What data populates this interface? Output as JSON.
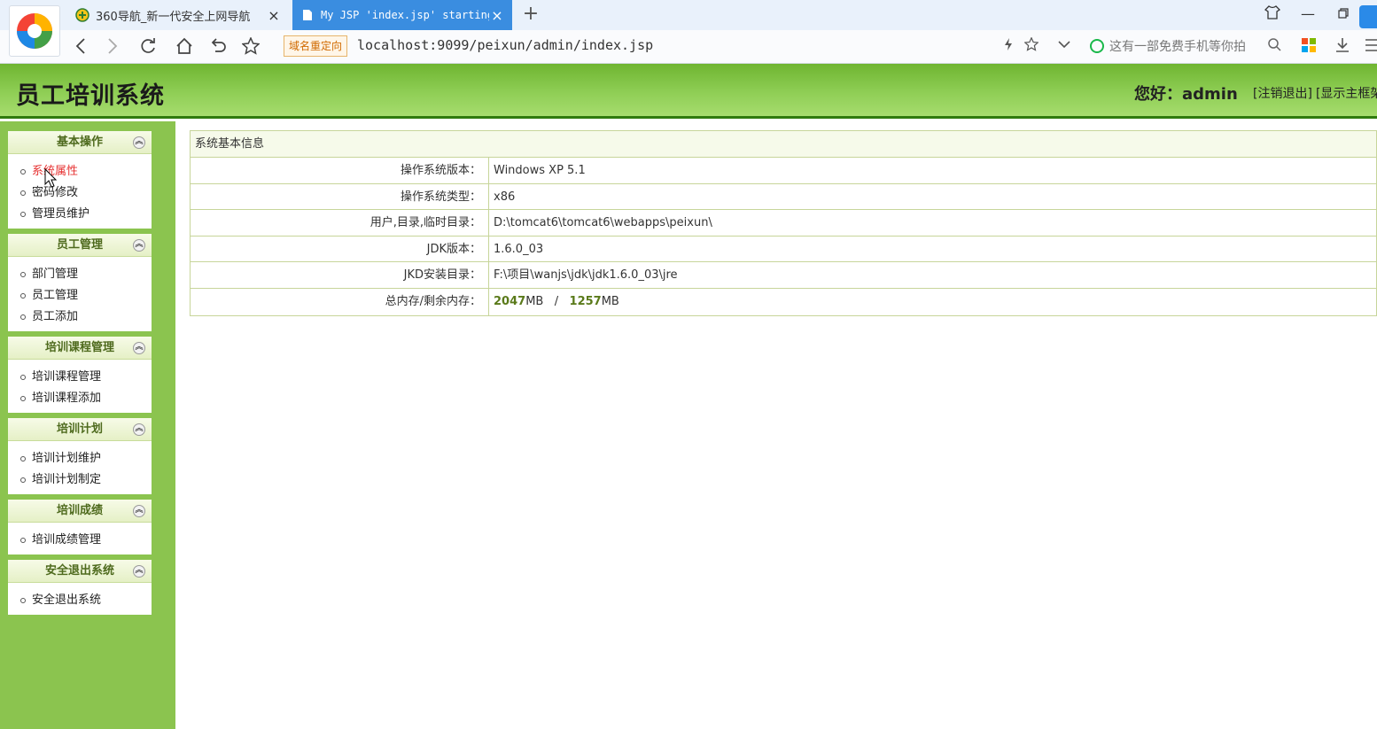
{
  "browser": {
    "tabs": [
      {
        "title": "360导航_新一代安全上网导航",
        "active": false
      },
      {
        "title": "My JSP 'index.jsp' starting",
        "active": true
      }
    ],
    "redirect_badge": "域名重定向",
    "url": "localhost:9099/peixun/admin/index.jsp",
    "search_placeholder": "这有一部免费手机等你拍",
    "accent": "#3a8de0"
  },
  "header": {
    "title": "员工培训系统",
    "greeting": "您好：admin",
    "logout_link": "[注销退出]",
    "show_frame_link": "[显示主框架"
  },
  "sidebar": {
    "groups": [
      {
        "title": "基本操作",
        "items": [
          "系统属性",
          "密码修改",
          "管理员维护"
        ]
      },
      {
        "title": "员工管理",
        "items": [
          "部门管理",
          "员工管理",
          "员工添加"
        ]
      },
      {
        "title": "培训课程管理",
        "items": [
          "培训课程管理",
          "培训课程添加"
        ]
      },
      {
        "title": "培训计划",
        "items": [
          "培训计划维护",
          "培训计划制定"
        ]
      },
      {
        "title": "培训成绩",
        "items": [
          "培训成绩管理"
        ]
      },
      {
        "title": "安全退出系统",
        "items": [
          "安全退出系统"
        ]
      }
    ],
    "active_item": "系统属性"
  },
  "info": {
    "title": "系统基本信息",
    "rows": [
      {
        "label": "操作系统版本：",
        "value": "Windows XP  5.1"
      },
      {
        "label": "操作系统类型：",
        "value": "x86"
      },
      {
        "label": "用户,目录,临时目录：",
        "value": "D:\\tomcat6\\tomcat6\\webapps\\peixun\\"
      },
      {
        "label": "JDK版本：",
        "value": "1.6.0_03"
      },
      {
        "label": "JKD安装目录：",
        "value": "F:\\项目\\wanjs\\jdk\\jdk1.6.0_03\\jre"
      }
    ],
    "memory_label": "总内存/剩余内存：",
    "memory_total": "2047",
    "memory_free": "1257",
    "memory_unit": "MB",
    "memory_sep": "/"
  }
}
